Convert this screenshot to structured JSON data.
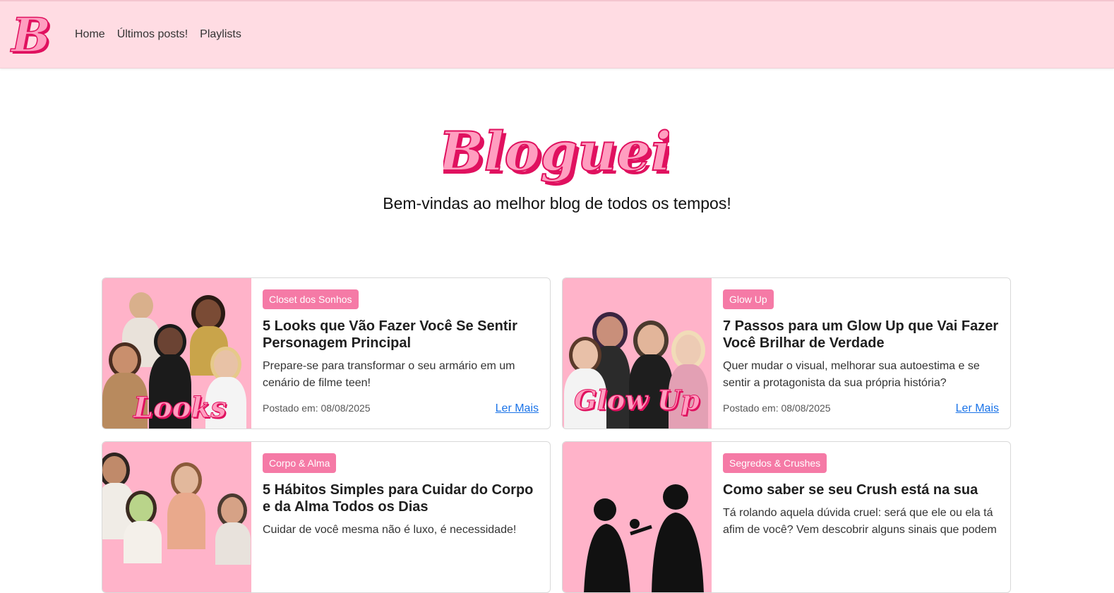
{
  "nav": {
    "logo_letter": "B",
    "links": [
      "Home",
      "Últimos posts!",
      "Playlists"
    ]
  },
  "hero": {
    "logo_text": "Bloguei",
    "tagline": "Bem-vindas ao melhor blog de todos os tempos!"
  },
  "colors": {
    "nav_bg": "#ffdce3",
    "badge_bg": "#f57aa6",
    "logo_pink": "#ff9ec0",
    "logo_dark": "#e0115f",
    "link": "#1a73e8"
  },
  "posts": [
    {
      "category": "Closet dos Sonhos",
      "title": "5 Looks que Vão Fazer Você Se Sentir Personagem Principal",
      "excerpt": "Prepare-se para transformar o seu armário em um cenário de filme teen!",
      "date": "Postado em: 08/08/2025",
      "more": "Ler Mais",
      "image_word": "Looks"
    },
    {
      "category": "Glow Up",
      "title": "7 Passos para um Glow Up que Vai Fazer Você Brilhar de Verdade",
      "excerpt": "Quer mudar o visual, melhorar sua autoestima e se sentir a protagonista da sua própria história?",
      "date": "Postado em: 08/08/2025",
      "more": "Ler Mais",
      "image_word": "Glow Up"
    },
    {
      "category": "Corpo & Alma",
      "title": "5 Hábitos Simples para Cuidar do Corpo e da Alma Todos os Dias",
      "excerpt": "Cuidar de você mesma não é luxo, é necessidade!",
      "date": "",
      "more": ""
    },
    {
      "category": "Segredos & Crushes",
      "title": "Como saber se seu Crush está na sua",
      "excerpt": "Tá rolando aquela dúvida cruel: será que ele ou ela tá afim de você? Vem descobrir alguns sinais que podem",
      "date": "",
      "more": ""
    }
  ]
}
